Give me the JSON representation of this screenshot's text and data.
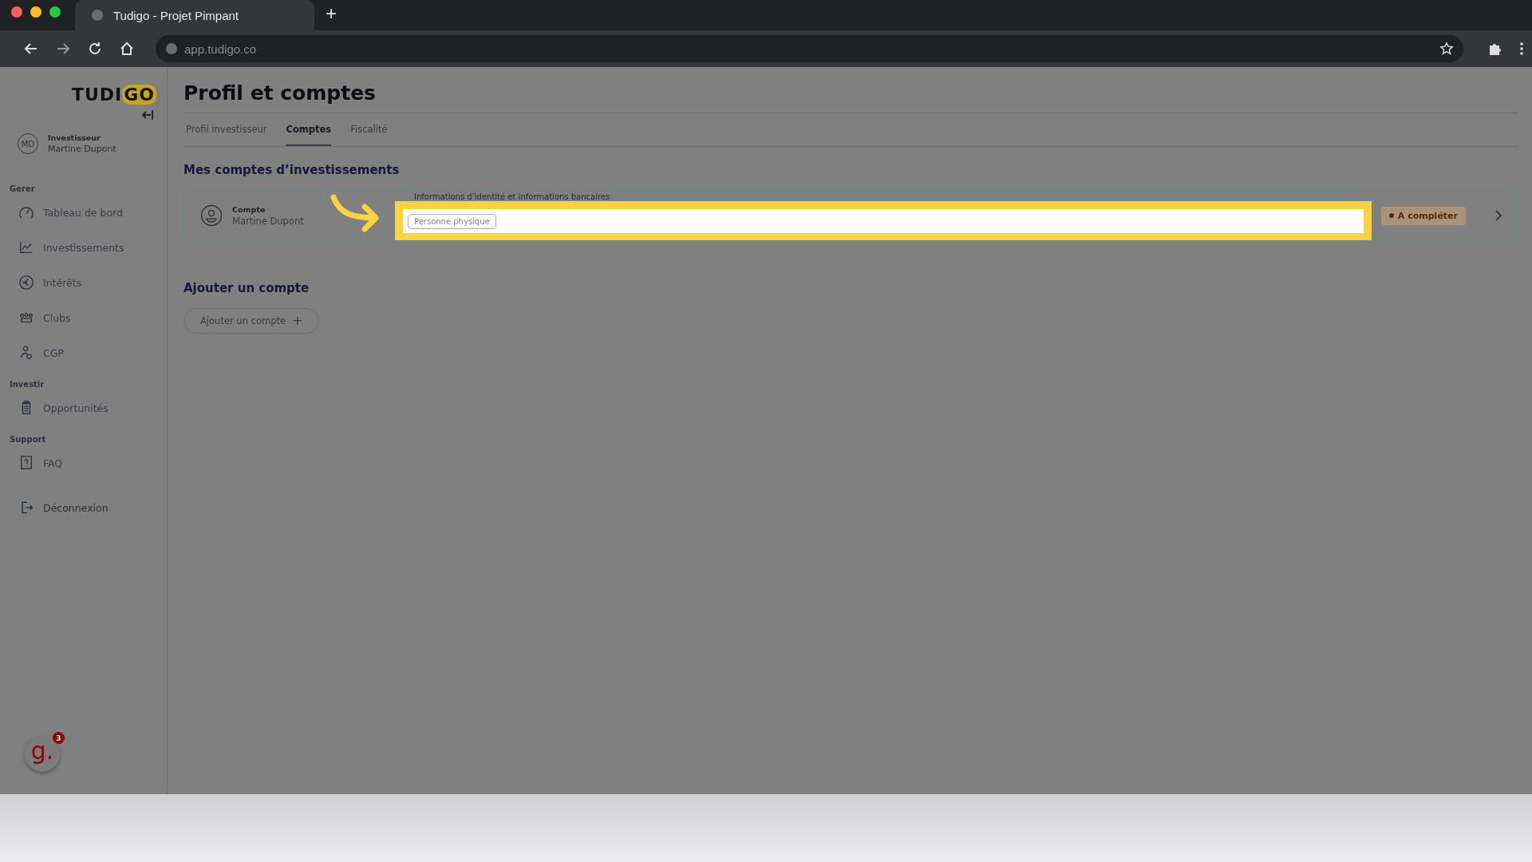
{
  "browser": {
    "tab_title": "Tudigo - Projet Pimpant",
    "new_tab": "+",
    "url": "app.tudigo.co"
  },
  "sidebar": {
    "logo": {
      "part_1": "TUDI",
      "part_2": "GO"
    },
    "user": {
      "initials": "MD",
      "role": "Investisseur",
      "name": "Martine Dupont"
    },
    "sections": [
      {
        "title": "Gerer",
        "items": [
          {
            "label": "Tableau de bord"
          },
          {
            "label": "Investissements"
          },
          {
            "label": "Intérêts"
          },
          {
            "label": "Clubs"
          },
          {
            "label": "CGP"
          }
        ]
      },
      {
        "title": "Investir",
        "items": [
          {
            "label": "Opportunités"
          }
        ]
      },
      {
        "title": "Support",
        "items": [
          {
            "label": "FAQ"
          }
        ]
      }
    ],
    "logout": "Déconnexion"
  },
  "page": {
    "title": "Profil et comptes",
    "tabs": [
      {
        "label": "Profil investisseur",
        "selected": false
      },
      {
        "label": "Comptes",
        "selected": true
      },
      {
        "label": "Fiscalité",
        "selected": false
      }
    ],
    "accounts_heading": "Mes comptes d’investissements",
    "account": {
      "type": "Compte",
      "name": "Martine Dupont",
      "caption": "Informations d’identité et informations bancaires",
      "tag": "Personne physique",
      "status": "A compléter"
    },
    "add_heading": "Ajouter un compte",
    "add_button": "Ajouter un compte",
    "add_icon": "+"
  },
  "help_widget": {
    "logo": "g.",
    "count": "3"
  }
}
